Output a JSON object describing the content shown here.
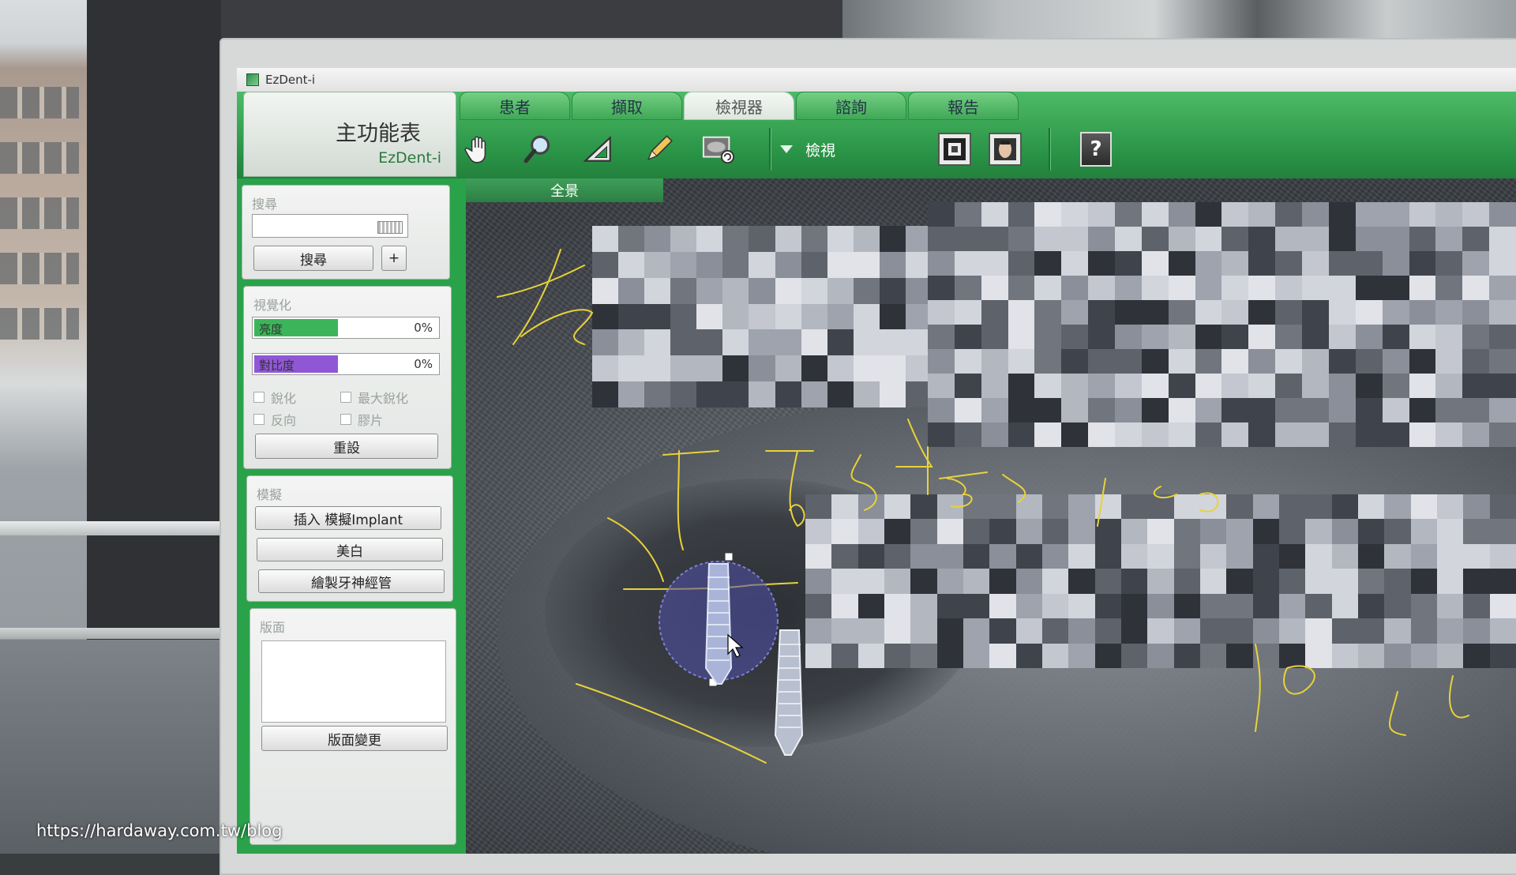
{
  "window": {
    "title": "EzDent-i"
  },
  "brand": {
    "main_title": "主功能表",
    "subtitle": "EzDent-i"
  },
  "tabs": [
    {
      "label": "患者",
      "active": false
    },
    {
      "label": "擷取",
      "active": false
    },
    {
      "label": "檢視器",
      "active": true
    },
    {
      "label": "諮詢",
      "active": false
    },
    {
      "label": "報告",
      "active": false
    }
  ],
  "toolbar": {
    "tools": [
      "hand-icon",
      "magnifier-icon",
      "triangle-ruler-icon",
      "pencil-icon",
      "image-rotate-icon"
    ],
    "view_dropdown_label": "檢視",
    "right_buttons": [
      "grid-view-icon",
      "face-view-icon",
      "help-icon"
    ],
    "help_label": "?"
  },
  "search": {
    "title": "搜尋",
    "input_value": "",
    "search_button": "搜尋",
    "add_button": "+"
  },
  "visualization": {
    "title": "視覺化",
    "brightness": {
      "label": "亮度",
      "value": "0%",
      "fill_fraction": 0.45,
      "color": "#3cb55a"
    },
    "contrast": {
      "label": "對比度",
      "value": "0%",
      "fill_fraction": 0.45,
      "color": "#8f57d6"
    },
    "checkboxes": {
      "sharpen": "銳化",
      "max_sharpen": "最大銳化",
      "invert": "反向",
      "film": "膠片"
    },
    "reset_button": "重設"
  },
  "simulation": {
    "title": "模擬",
    "insert_implant_button": "插入 模擬Implant",
    "whitening_button": "美白",
    "draw_nerve_button": "繪製牙神經管"
  },
  "layout": {
    "title": "版面",
    "change_button": "版面變更"
  },
  "viewer": {
    "tab_label": "全景"
  },
  "watermark": "https://hardaway.com.tw/blog",
  "colors": {
    "accent_green": "#2aa24a",
    "annotation_yellow": "#e8d23a"
  }
}
